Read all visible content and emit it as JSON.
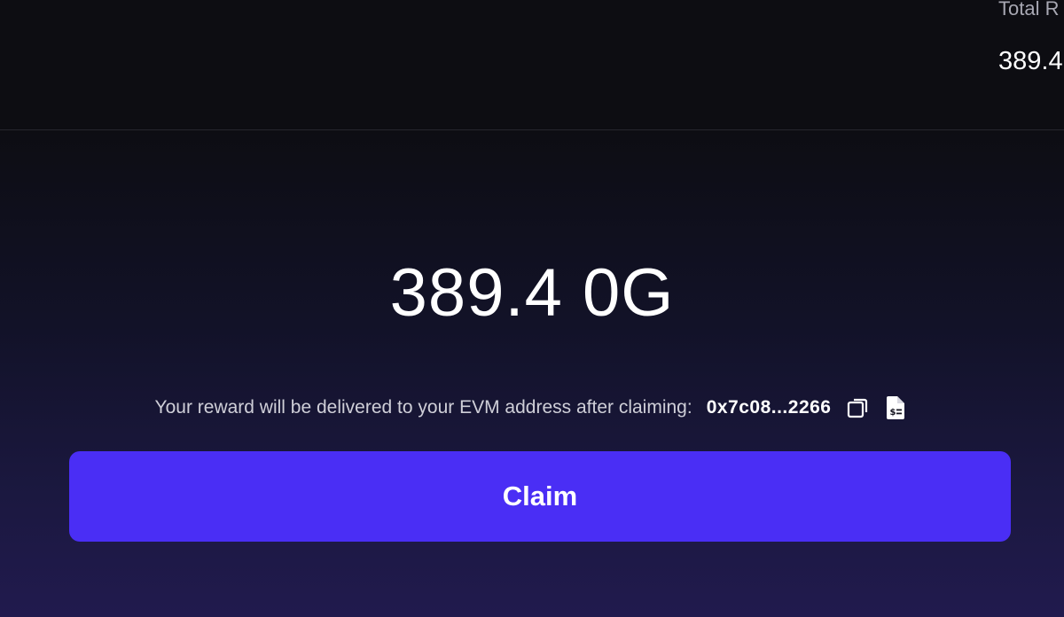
{
  "stats": {
    "total_label": "Total R",
    "total_value": "389.4"
  },
  "claim": {
    "amount": "389.4 0G",
    "notice": "Your reward will be delivered to your EVM address after claiming:",
    "address": "0x7c08...2266",
    "button_label": "Claim",
    "icons": [
      "copy-icon",
      "dollar-document-icon"
    ]
  },
  "colors": {
    "accent": "#4a2ef5",
    "background": "#0d0d12",
    "gradient_end": "#211a4e"
  }
}
